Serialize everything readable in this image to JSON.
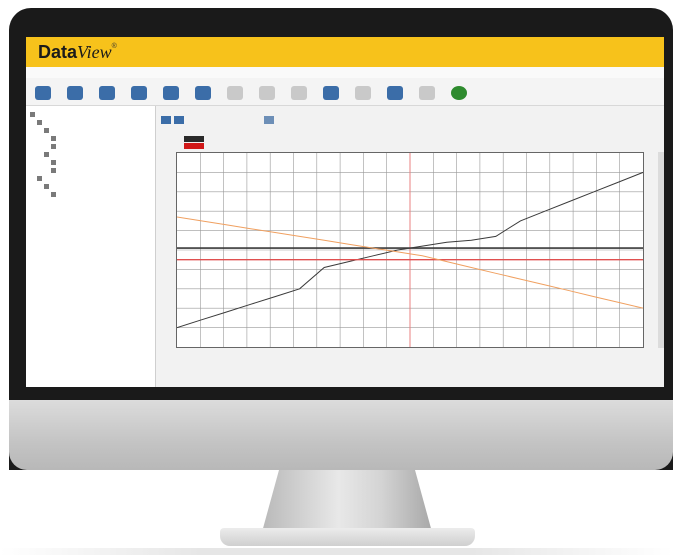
{
  "app": {
    "title_data": "Data",
    "title_view": "View",
    "title_mark": "®"
  },
  "colors": {
    "title_bar": "#f7c21b",
    "selection": "#3b6da8",
    "series_dark": "#3a3a3a",
    "series_red": "#e05050",
    "series_orange": "#f0a060",
    "cursor": "#e88080"
  },
  "toolbar": {
    "buttons": [
      {
        "icon": "open-icon",
        "label": ""
      },
      {
        "icon": "report-icon",
        "label": ""
      },
      {
        "icon": "print-icon",
        "label": ""
      },
      {
        "icon": "export-icon",
        "label": ""
      },
      {
        "icon": "instrument-icon",
        "label": ""
      },
      {
        "icon": "graph-icon",
        "label": ""
      },
      {
        "icon": "table-icon",
        "label": ""
      },
      {
        "icon": "cursor-icon",
        "label": ""
      },
      {
        "icon": "delete-icon",
        "label": ""
      },
      {
        "icon": "zoom-in-icon",
        "label": ""
      },
      {
        "icon": "zoom-out-icon",
        "label": ""
      },
      {
        "icon": "pan-icon",
        "label": ""
      },
      {
        "icon": "settings-icon",
        "label": ""
      },
      {
        "icon": "help-icon",
        "label": ""
      }
    ]
  },
  "tree": {
    "items": [
      {
        "label": "",
        "level": 0
      },
      {
        "label": "",
        "level": 1
      },
      {
        "label": "",
        "level": 2
      },
      {
        "label": "",
        "level": 3
      },
      {
        "label": "",
        "level": 3
      },
      {
        "label": "",
        "level": 2
      },
      {
        "label": "",
        "level": 3
      },
      {
        "label": "",
        "level": 3
      },
      {
        "label": "",
        "level": 1
      },
      {
        "label": "",
        "level": 2
      },
      {
        "label": "",
        "level": 3,
        "selected": true
      }
    ],
    "status_text": ""
  },
  "panel": {
    "title": "",
    "tabs": [
      "",
      ""
    ],
    "right_tab": ""
  },
  "chart_data": {
    "type": "line",
    "title": "",
    "xlabel": "",
    "ylabel": "",
    "grid": true,
    "series": [
      {
        "values": [
          -80,
          -72,
          -64,
          -56,
          -48,
          -40,
          -18,
          -12,
          -6,
          0,
          4,
          8,
          10,
          14,
          30,
          40,
          50,
          60,
          70,
          80
        ]
      },
      {
        "values": [
          2,
          2,
          2,
          2,
          2,
          2,
          2,
          2,
          2,
          2,
          2,
          2,
          2,
          2,
          2,
          2,
          2,
          2,
          2,
          2
        ]
      },
      {
        "values": [
          -10,
          -10,
          -10,
          -10,
          -10,
          -10,
          -10,
          -10,
          -10,
          -10,
          -10,
          -10,
          -10,
          -10,
          -10,
          -10,
          -10,
          -10,
          -10,
          -10
        ]
      },
      {
        "values": [
          34,
          30,
          26,
          22,
          18,
          14,
          10,
          6,
          2,
          -2,
          -6,
          -12,
          -18,
          -24,
          -30,
          -36,
          -42,
          -48,
          -54,
          -60
        ]
      }
    ]
  }
}
